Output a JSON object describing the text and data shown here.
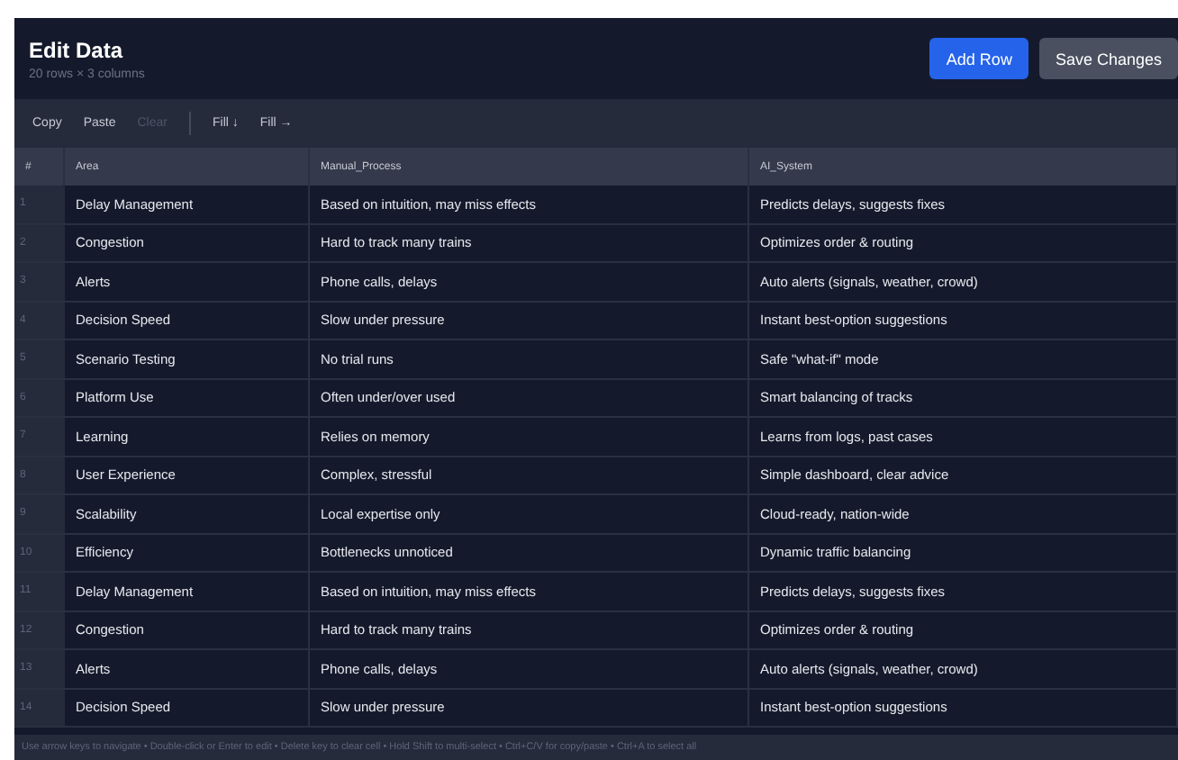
{
  "header": {
    "title": "Edit Data",
    "subtitle": "20 rows × 3 columns",
    "buttons": [
      {
        "label": "Add Row",
        "kind": "primary"
      },
      {
        "label": "Save Changes",
        "kind": "secondary"
      }
    ]
  },
  "toolbar": [
    {
      "label": "Copy",
      "disabled": false
    },
    {
      "label": "Paste",
      "disabled": false
    },
    {
      "label": "Clear",
      "disabled": true
    },
    {
      "label": "Fill ↓",
      "disabled": false
    },
    {
      "label": "Fill →",
      "disabled": false
    }
  ],
  "table": {
    "columns": [
      "#",
      "Area",
      "Manual_Process",
      "AI_System"
    ],
    "rows": [
      [
        "1",
        "Delay Management",
        "Based on intuition, may miss effects",
        "Predicts delays, suggests fixes"
      ],
      [
        "2",
        "Congestion",
        "Hard to track many trains",
        "Optimizes order & routing"
      ],
      [
        "3",
        "Alerts",
        "Phone calls, delays",
        "Auto alerts (signals, weather, crowd)"
      ],
      [
        "4",
        "Decision Speed",
        "Slow under pressure",
        "Instant best-option suggestions"
      ],
      [
        "5",
        "Scenario Testing",
        "No trial runs",
        "Safe \"what-if\" mode"
      ],
      [
        "6",
        "Platform Use",
        "Often under/over used",
        "Smart balancing of tracks"
      ],
      [
        "7",
        "Learning",
        "Relies on memory",
        "Learns from logs, past cases"
      ],
      [
        "8",
        "User Experience",
        "Complex, stressful",
        "Simple dashboard, clear advice"
      ],
      [
        "9",
        "Scalability",
        "Local expertise only",
        "Cloud-ready, nation-wide"
      ],
      [
        "10",
        "Efficiency",
        "Bottlenecks unnoticed",
        "Dynamic traffic balancing"
      ],
      [
        "11",
        "Delay Management",
        "Based on intuition, may miss effects",
        "Predicts delays, suggests fixes"
      ],
      [
        "12",
        "Congestion",
        "Hard to track many trains",
        "Optimizes order & routing"
      ],
      [
        "13",
        "Alerts",
        "Phone calls, delays",
        "Auto alerts (signals, weather, crowd)"
      ],
      [
        "14",
        "Decision Speed",
        "Slow under pressure",
        "Instant best-option suggestions"
      ]
    ]
  },
  "status_bar": "Use arrow keys to navigate • Double-click or Enter to edit • Delete key to clear cell • Hold Shift to multi-select • Ctrl+C/V for copy/paste • Ctrl+A to select all"
}
